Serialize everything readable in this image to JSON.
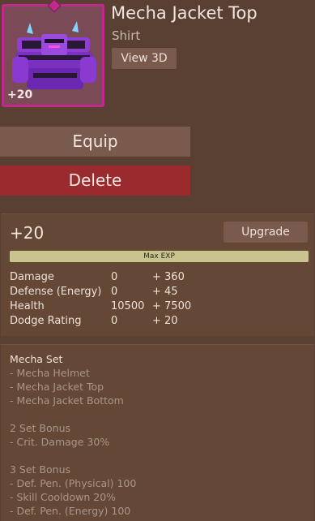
{
  "item": {
    "name": "Mecha Jacket Top",
    "type": "Shirt",
    "level_badge": "+20",
    "rarity_color": "#c22a8a",
    "icon": "purple-armor-torso-icon"
  },
  "actions": {
    "view3d_label": "View 3D",
    "equip_label": "Equip",
    "delete_label": "Delete",
    "upgrade_label": "Upgrade"
  },
  "progress": {
    "level": "+20",
    "exp_label": "Max EXP",
    "exp_fraction": 1.0
  },
  "stats": [
    {
      "name": "Damage",
      "base": "0",
      "bonus": "+ 360"
    },
    {
      "name": "Defense (Energy)",
      "base": "0",
      "bonus": "+ 45"
    },
    {
      "name": "Health",
      "base": "10500",
      "bonus": "+ 7500"
    },
    {
      "name": "Dodge Rating",
      "base": "0",
      "bonus": "+ 20"
    }
  ],
  "set_info": {
    "set_name": "Mecha Set",
    "pieces": [
      "- Mecha Helmet",
      "- Mecha Jacket Top",
      "- Mecha Jacket Bottom"
    ],
    "bonus2_title": "2 Set Bonus",
    "bonus2_lines": [
      "- Crit. Damage 30%"
    ],
    "bonus3_title": "3 Set Bonus",
    "bonus3_lines": [
      "- Def. Pen. (Physical) 100",
      "- Skill Cooldown 20%",
      "- Def. Pen. (Energy) 100"
    ]
  }
}
